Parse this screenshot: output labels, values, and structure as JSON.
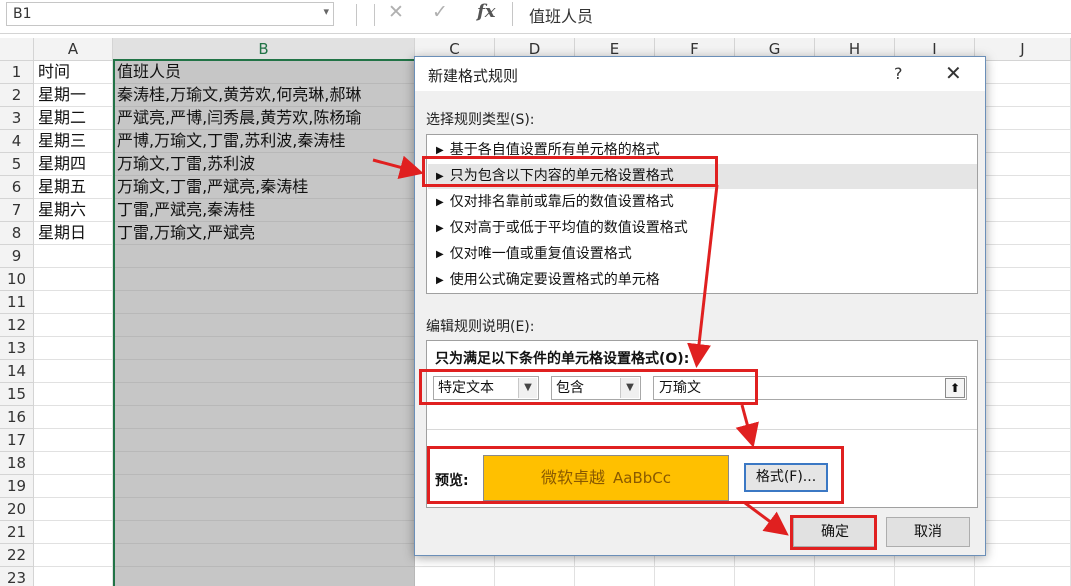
{
  "formula_bar": {
    "name_box": "B1",
    "cancel_icon": "✕",
    "enter_icon": "✓",
    "fx": "fx",
    "content": "值班人员"
  },
  "columns": [
    "A",
    "B",
    "C",
    "D",
    "E",
    "F",
    "G",
    "H",
    "I",
    "J"
  ],
  "rows": [
    "1",
    "2",
    "3",
    "4",
    "5",
    "6",
    "7",
    "8",
    "9",
    "10",
    "11",
    "12",
    "13",
    "14",
    "15",
    "16",
    "17",
    "18",
    "19",
    "20",
    "21",
    "22",
    "23"
  ],
  "cells": [
    {
      "a": "时间",
      "b": "值班人员"
    },
    {
      "a": "星期一",
      "b": "秦涛桂,万瑜文,黄芳欢,何亮琳,郝琳"
    },
    {
      "a": "星期二",
      "b": "严斌亮,严博,闫秀晨,黄芳欢,陈杨瑜"
    },
    {
      "a": "星期三",
      "b": "严博,万瑜文,丁雷,苏利波,秦涛桂"
    },
    {
      "a": "星期四",
      "b": "万瑜文,丁雷,苏利波"
    },
    {
      "a": "星期五",
      "b": "万瑜文,丁雷,严斌亮,秦涛桂"
    },
    {
      "a": "星期六",
      "b": "丁雷,严斌亮,秦涛桂"
    },
    {
      "a": "星期日",
      "b": "丁雷,万瑜文,严斌亮"
    }
  ],
  "dialog": {
    "title": "新建格式规则",
    "help": "?",
    "close": "✕",
    "rule_type_label": "选择规则类型(S):",
    "rule_types": [
      "基于各自值设置所有单元格的格式",
      "只为包含以下内容的单元格设置格式",
      "仅对排名靠前或靠后的数值设置格式",
      "仅对高于或低于平均值的数值设置格式",
      "仅对唯一值或重复值设置格式",
      "使用公式确定要设置格式的单元格"
    ],
    "selected_rule_index": 1,
    "edit_label": "编辑规则说明(E):",
    "condition_title": "只为满足以下条件的单元格设置格式(O):",
    "condition_type": "特定文本",
    "operator": "包含",
    "value": "万瑜文",
    "preview_label": "预览:",
    "preview_text": "微软卓越",
    "preview_latin": "AaBbCc",
    "preview_color": "#ffc000",
    "format_button": "格式(F)...",
    "ok_button": "确定",
    "cancel_button": "取消"
  },
  "colors": {
    "selection_fill": "#c6c6c6",
    "excel_green": "#217346",
    "annotation_red": "#e02020"
  }
}
